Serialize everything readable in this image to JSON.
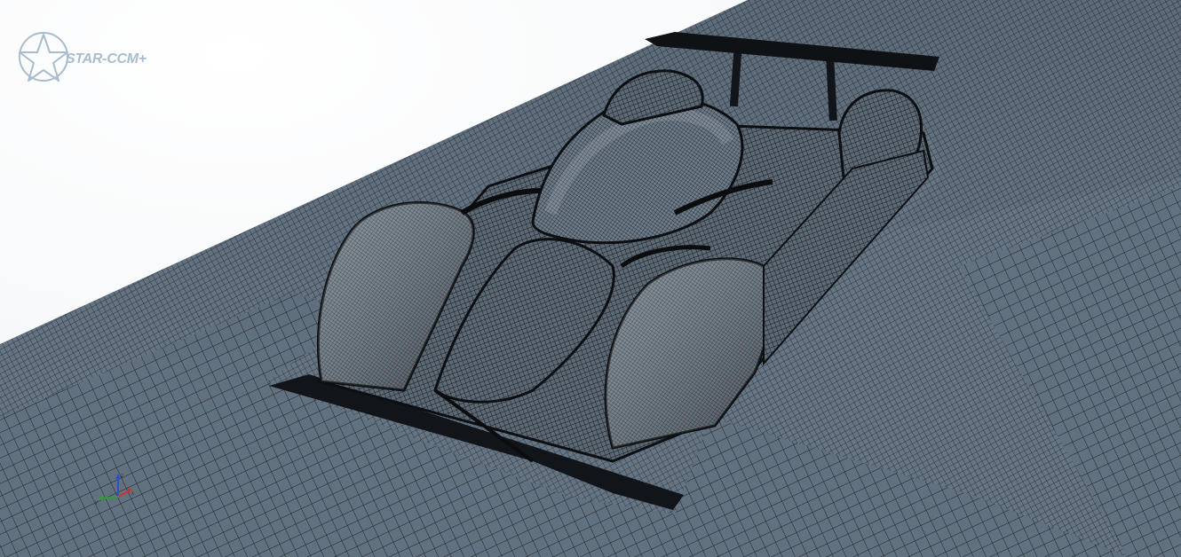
{
  "app": {
    "logo_text": "STAR-CCM+"
  },
  "viewport": {
    "view": "mesh-scene",
    "colors": {
      "background": "#ffffff",
      "mesh_face": "#5f6e7c",
      "mesh_line": "#1c2127",
      "car_face": "#4a5560",
      "logo": "#a9bccd"
    }
  },
  "triad": {
    "axes": [
      "x",
      "y",
      "z"
    ],
    "colors": {
      "x": "#d23030",
      "y": "#2f9e3a",
      "z": "#2a4fd0"
    }
  }
}
